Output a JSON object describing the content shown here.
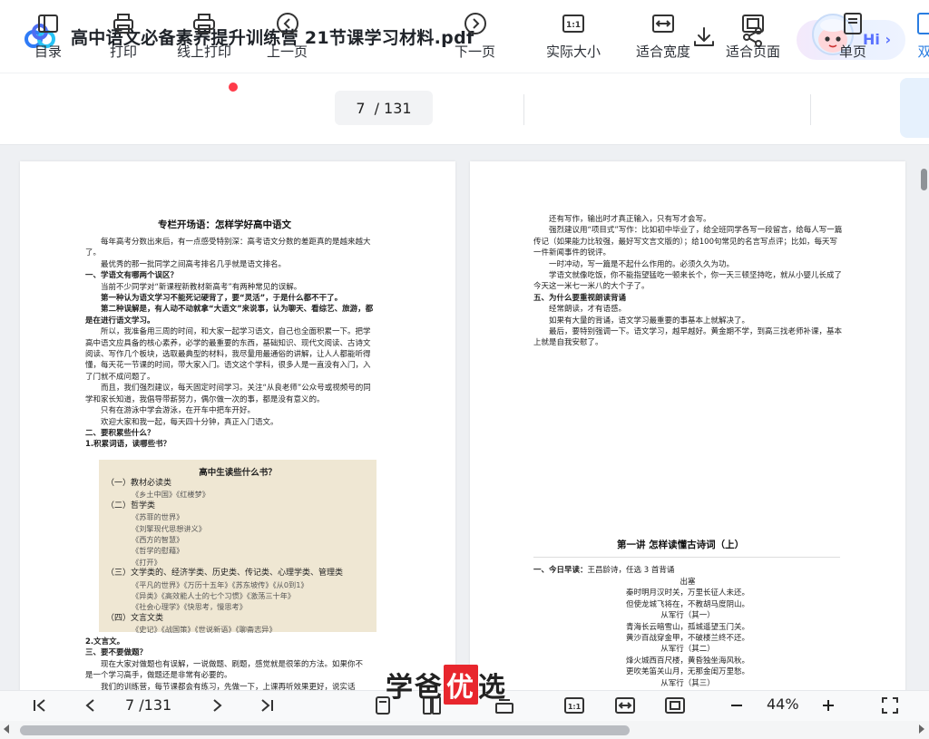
{
  "app": {
    "accent": "#3b82f6"
  },
  "title": "高中语文必备素养提升训练营 21节课学习材料.pdf",
  "assistant": {
    "label": "Hi",
    "icon": "chevron-right-icon"
  },
  "toolbar": {
    "items": [
      {
        "id": "toc",
        "label": "目录",
        "icon": "toc-icon"
      },
      {
        "id": "print",
        "label": "打印",
        "icon": "printer-icon"
      },
      {
        "id": "online-print",
        "label": "线上打印",
        "icon": "cloud-printer-icon"
      },
      {
        "id": "prev",
        "label": "上一页",
        "icon": "arrow-left-circle-icon"
      },
      {
        "id": "next",
        "label": "下一页",
        "icon": "arrow-right-circle-icon"
      },
      {
        "id": "actual",
        "label": "实际大小",
        "icon": "actual-size-icon"
      },
      {
        "id": "fit-width",
        "label": "适合宽度",
        "icon": "fit-width-icon"
      },
      {
        "id": "fit-page",
        "label": "适合页面",
        "icon": "fit-page-icon"
      },
      {
        "id": "single",
        "label": "单页",
        "icon": "single-page-icon"
      },
      {
        "id": "double",
        "label": "双",
        "icon": "double-page-icon"
      }
    ],
    "page_current": "7",
    "page_total": "/ 131"
  },
  "left_page": {
    "title": "专栏开场语：怎样学好高中语文",
    "lines": [
      {
        "t": "每年高考分数出来后，有一点感受特别深：高考语文分数的差距真的是越来越大",
        "b": false,
        "i": true
      },
      {
        "t": "了。",
        "b": false,
        "i": false
      },
      {
        "t": "最优秀的那一批同学之间高考排名几乎就是语文排名。",
        "b": false,
        "i": true
      },
      {
        "t": "一、学语文有哪两个误区？",
        "b": true,
        "i": false
      },
      {
        "t": "当前不少同学对“新课程新教材新高考”有两种常见的误解。",
        "b": false,
        "i": true
      },
      {
        "t": "第一种认为语文学习不能死记硬背了，要“灵活”，于是什么都不干了。",
        "b": true,
        "i": true
      },
      {
        "t": "第二种误解是，有人动不动就拿“大语文”来说事，认为聊天、看综艺、旅游，都",
        "b": true,
        "i": true
      },
      {
        "t": "是在进行语文学习。",
        "b": true,
        "i": false
      },
      {
        "t": "所以，我准备用三周的时间，和大家一起学习语文，自己也全面积累一下。把学",
        "b": false,
        "i": true
      },
      {
        "t": "高中语文应具备的核心素养，必学的最重要的东西，基础知识、现代文阅读、古诗文",
        "b": false,
        "i": false
      },
      {
        "t": "阅读、写作几个板块，选取最典型的材料，我尽量用最通俗的讲解，让人人都能听得",
        "b": false,
        "i": false
      },
      {
        "t": "懂，每天花一节课的时间，带大家入门。语文这个学科，很多人是一直没有入门，入",
        "b": false,
        "i": false
      },
      {
        "t": "了门就不成问题了。",
        "b": false,
        "i": false
      },
      {
        "t": "而且，我们强烈建议，每天固定时间学习。关注“从良老师”公众号或视频号的同",
        "b": false,
        "i": true
      },
      {
        "t": "学和家长知道，我倡导带薪努力，偶尔做一次的事，都是没有意义的。",
        "b": false,
        "i": false
      },
      {
        "t": "只有在游泳中学会游泳，在开车中把车开好。",
        "b": false,
        "i": true
      },
      {
        "t": "欢迎大家和我一起，每天四十分钟，真正入门语文。",
        "b": false,
        "i": true
      },
      {
        "t": "二、要积累些什么？",
        "b": true,
        "i": false
      },
      {
        "t": "1.积累词语，读哪些书？",
        "b": true,
        "i": false
      }
    ],
    "bookbox": {
      "title": "高中生读些什么书？",
      "lines": [
        {
          "t": "（一）教材必读类",
          "it": false
        },
        {
          "t": "《乡土中国》《红楼梦》",
          "it": true
        },
        {
          "t": "（二）哲学类",
          "it": false
        },
        {
          "t": "《苏菲的世界》",
          "it": true
        },
        {
          "t": "《刘擎现代思想讲义》",
          "it": true
        },
        {
          "t": "《西方的智慧》",
          "it": true
        },
        {
          "t": "《哲学的慰藉》",
          "it": true
        },
        {
          "t": "《打开》",
          "it": true
        },
        {
          "t": "（三）文学类的、经济学类、历史类、传记类、心理学类、管理类",
          "it": false
        },
        {
          "t": "《平凡的世界》《万历十五年》《苏东坡传》《从0到1》",
          "it": true
        },
        {
          "t": "《异类》《高效能人士的七个习惯》《激荡三十年》",
          "it": true
        },
        {
          "t": "《社会心理学》《快思考，慢思考》",
          "it": true
        },
        {
          "t": "（四）文言文类",
          "it": false
        },
        {
          "t": "《史记》《战国策》《世说新语》《聊斋志异》",
          "it": true
        }
      ]
    },
    "after_lines": [
      {
        "t": "2.文言文。",
        "b": true,
        "i": false
      },
      {
        "t": "三、要不要做题？",
        "b": true,
        "i": false
      },
      {
        "t": "现在大家对做题也有误解，一说做题、刷题，感觉就是很笨的方法。如果你不",
        "b": false,
        "i": true
      },
      {
        "t": "是一个学习高手，做题还是非常有必要的。",
        "b": false,
        "i": false
      },
      {
        "t": "我们的训练营，每节课都会有练习，先做一下，上课再听效果更好，说实话",
        "b": false,
        "i": true
      }
    ]
  },
  "right_page": {
    "lines": [
      {
        "t": "还有写作，输出时才真正输入，只有写才会写。",
        "b": false,
        "i": true
      },
      {
        "t": "强烈建议用“项目式”写作：比如初中毕业了，给全班同学各写一段留言，给每人写一篇",
        "b": false,
        "i": true
      },
      {
        "t": "传记（如果能力比较强，最好写文言文版的）；给100句常见的名言写点评；比如，每天写",
        "b": false,
        "i": false
      },
      {
        "t": "一件新闻事件的锐评。",
        "b": false,
        "i": false
      },
      {
        "t": "一时冲动，写一篇是不起什么作用的。必须久久为功。",
        "b": false,
        "i": true
      },
      {
        "t": "学语文就像吃饭，你不能指望猛吃一顿来长个，你一天三顿坚持吃，就从小婴儿长成了",
        "b": false,
        "i": true
      },
      {
        "t": "今天这一米七一米八的大个子了。",
        "b": false,
        "i": false
      },
      {
        "t": "五、为什么要重视朗读背诵",
        "b": true,
        "i": false
      },
      {
        "t": "经常朗读，才有语感。",
        "b": false,
        "i": true
      },
      {
        "t": "如果有大量的背诵，语文学习最重要的事基本上就解决了。",
        "b": false,
        "i": true
      },
      {
        "t": "最后，要特别强调一下。语文学习，越早越好。黄金期不学，到高三找老师补课，基本",
        "b": false,
        "i": true
      },
      {
        "t": "上就是自我安慰了。",
        "b": false,
        "i": false
      }
    ],
    "lesson_title": "第一讲  怎样读懂古诗词（上）",
    "today_label": "一、今日早读：",
    "today_text": "王昌龄诗，任选 3 首背诵",
    "poem": [
      "出塞",
      "秦时明月汉时关，万里长征人未还。",
      "但使龙城飞将在，不教胡马度阴山。",
      "从军行（其一）",
      "青海长云暗雪山，孤城遥望玉门关。",
      "黄沙百战穿金甲，不破楼兰终不还。",
      "从军行（其二）",
      "烽火城西百尺楼，黄昏独坐海风秋。",
      "更吹羌笛关山月，无那金闺万里愁。",
      "从军行（其三）"
    ]
  },
  "bottom": {
    "page_current": "7",
    "page_total": "/131",
    "zoom": "44%",
    "watermark_1": "学爸",
    "watermark_2": "优",
    "watermark_3": "选"
  }
}
